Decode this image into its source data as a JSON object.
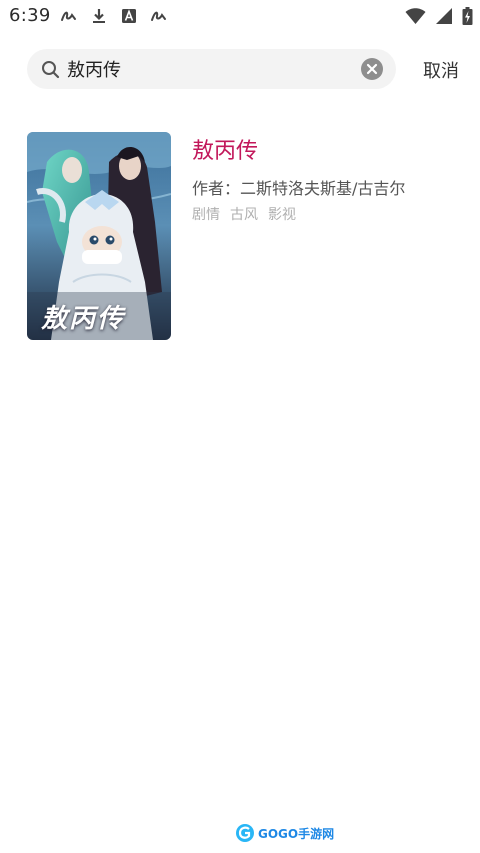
{
  "status_bar": {
    "time": "6:39",
    "left_icons": [
      "signature-icon",
      "download-icon",
      "a-app-icon",
      "signature-icon"
    ],
    "right_icons": [
      "wifi-icon",
      "signal-icon",
      "battery-icon"
    ]
  },
  "search": {
    "value": "敖丙传",
    "cancel_label": "取消"
  },
  "results": [
    {
      "title": "敖丙传",
      "author": "作者：二斯特洛夫斯基/古吉尔",
      "tags": [
        "剧情",
        "古风",
        "影视"
      ],
      "poster_text": "敖丙传"
    }
  ],
  "watermark": {
    "text": "GOGO手游网"
  },
  "colors": {
    "title": "#c2185b",
    "search_bg": "#f3f3f3",
    "tag": "#b0b0b0",
    "watermark": "#1e88e5"
  }
}
